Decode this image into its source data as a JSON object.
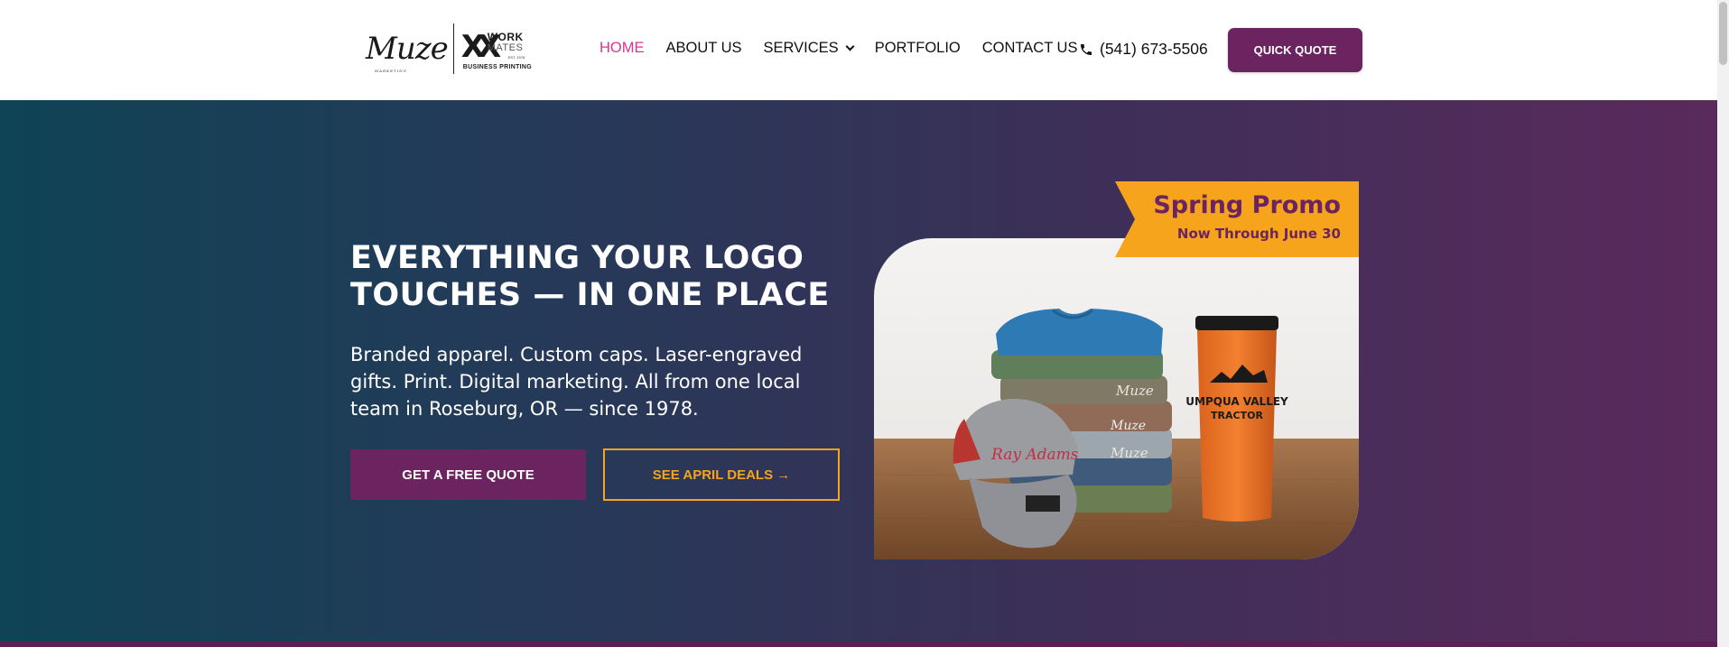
{
  "logo": {
    "muze": "Muze",
    "muze_sub": "MARKETING",
    "workmates_work": "WORK",
    "workmates_mates": "MATES",
    "workmates_est": "EST. 1978",
    "workmates_tagline": "BUSINESS PRINTING"
  },
  "nav": {
    "items": [
      {
        "label": "HOME",
        "active": true
      },
      {
        "label": "ABOUT US"
      },
      {
        "label": "SERVICES",
        "has_dropdown": true
      },
      {
        "label": "PORTFOLIO"
      },
      {
        "label": "CONTACT US"
      }
    ],
    "phone": "(541) 673-5506",
    "quick_quote": "QUICK QUOTE"
  },
  "hero": {
    "headline": "EVERYTHING YOUR LOGO TOUCHES — IN ONE PLACE",
    "subtext": "Branded apparel. Custom caps. Laser-engraved gifts. Print. Digital marketing. All from one local team in Roseburg, OR — since 1978.",
    "primary_button": "GET A FREE QUOTE",
    "secondary_button": "SEE APRIL DEALS →",
    "promo": {
      "title": "Spring Promo",
      "subtitle": "Now Through June 30"
    },
    "product_image": {
      "tumbler_text_1": "UMPQUA VALLEY",
      "tumbler_text_2": "TRACTOR",
      "shirt_text": "Muze",
      "cap_text": "Ray Adams"
    }
  },
  "colors": {
    "accent_pink": "#d8368d",
    "brand_purple": "#6b2460",
    "promo_orange": "#f5a41c",
    "hero_gradient_start": "#0f4356",
    "hero_gradient_end": "#5a2a5c"
  }
}
